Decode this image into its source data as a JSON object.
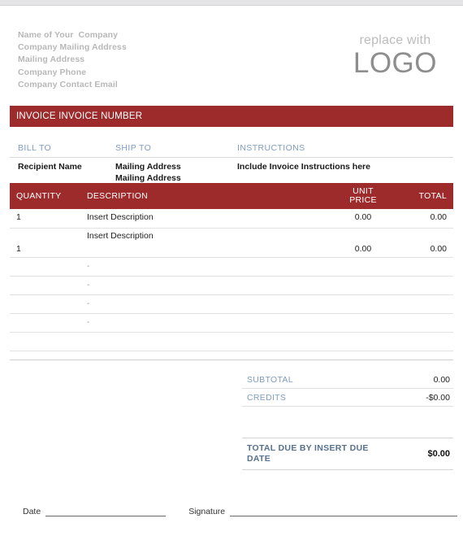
{
  "header": {
    "company_lines": [
      "Name of Your  Company",
      "Company Mailing Address",
      "Mailing Address",
      "Company Phone",
      "Company Contact Email"
    ],
    "logo_sub": "replace with",
    "logo_main": "LOGO"
  },
  "banner": {
    "title": "INVOICE INVOICE NUMBER"
  },
  "parties": {
    "bill_to_label": "BILL TO",
    "ship_to_label": "SHIP TO",
    "instructions_label": "INSTRUCTIONS",
    "bill_to_value": "Recipient Name",
    "ship_to_line1": "Mailing Address",
    "ship_to_line2": "Mailing Address",
    "instructions_value": "Include Invoice Instructions here"
  },
  "items_table": {
    "columns": {
      "quantity": "QUANTITY",
      "description": "DESCRIPTION",
      "unit_price_line1": "UNIT",
      "unit_price_line2": "PRICE",
      "total": "TOTAL"
    },
    "rows": [
      {
        "quantity": "1",
        "description": "Insert Description",
        "unit_price": "0.00",
        "total": "0.00"
      },
      {
        "quantity": "1",
        "description": "Insert Description",
        "unit_price": "0.00",
        "total": "0.00"
      }
    ],
    "empty_rows": [
      {
        "dash": "-"
      },
      {
        "dash": "-"
      },
      {
        "dash": "-"
      },
      {
        "dash": "-"
      },
      {
        "dash": ""
      }
    ]
  },
  "totals": {
    "subtotal_label": "SUBTOTAL",
    "subtotal_value": "0.00",
    "credits_label": "CREDITS",
    "credits_value": "-$0.00",
    "grand_total_label": "TOTAL DUE BY INSERT DUE DATE",
    "grand_total_value": "$0.00"
  },
  "signature": {
    "date_label": "Date",
    "signature_label": "Signature"
  },
  "colors": {
    "brand_red": "#9e2b2b",
    "accent_blue": "#7e9cc0",
    "muted_gray": "#b8b8b8"
  }
}
